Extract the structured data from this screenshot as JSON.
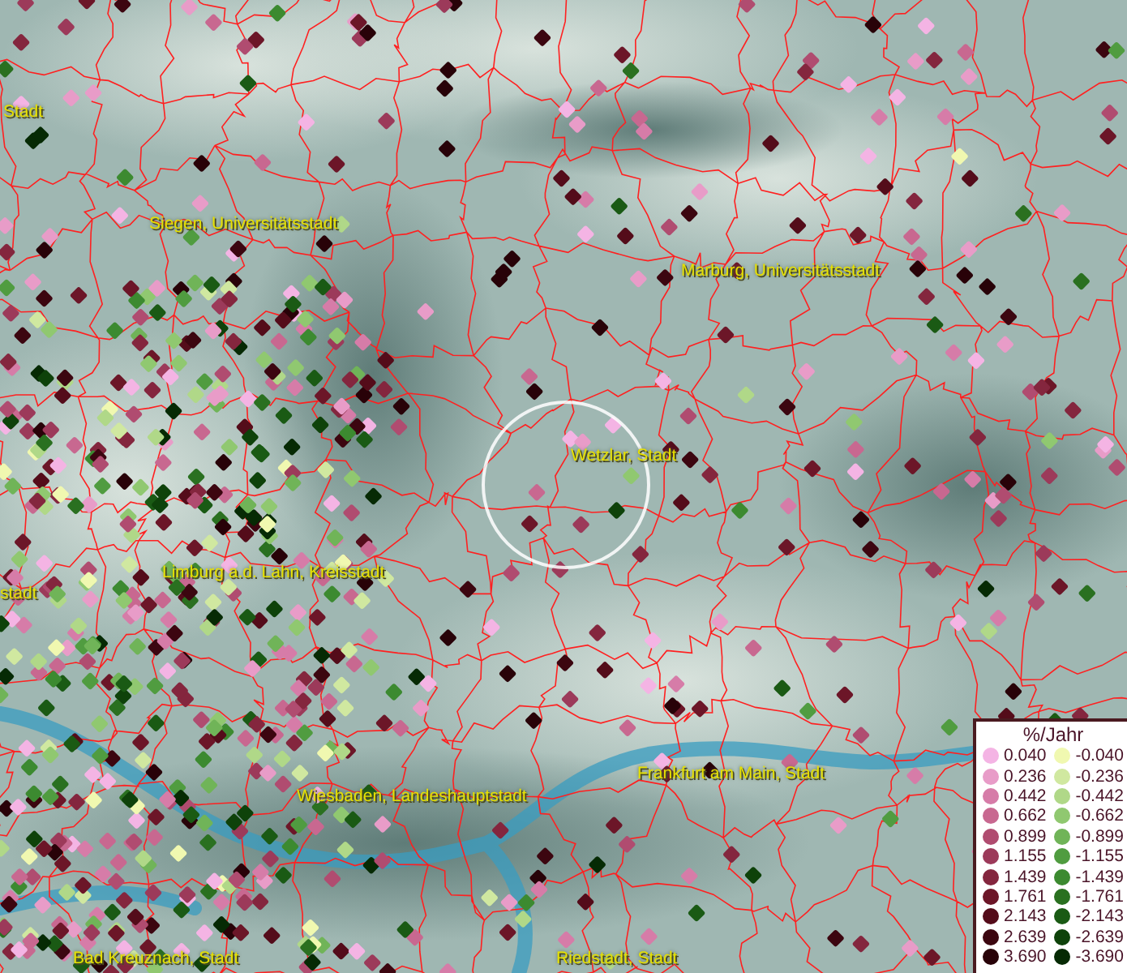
{
  "map": {
    "labels": [
      {
        "text": "Stadt"
      },
      {
        "text": "Siegen, Universitätsstadt"
      },
      {
        "text": "Marburg, Universitätsstadt"
      },
      {
        "text": "Wetzlar, Stadt"
      },
      {
        "text": "Limburg a.d. Lahn, Kreisstadt"
      },
      {
        "text": "stadt"
      },
      {
        "text": "Wiesbaden, Landeshauptstadt"
      },
      {
        "text": "Frankfurt am Main, Stadt"
      },
      {
        "text": "Bad Kreuznach, Stadt"
      },
      {
        "text": "Riedstadt, Stadt"
      }
    ]
  },
  "legend": {
    "title": "%/Jahr",
    "columns": [
      [
        {
          "label": "0.040",
          "color": "#f4b4e4"
        },
        {
          "label": "0.236",
          "color": "#e89cc8"
        },
        {
          "label": "0.442",
          "color": "#d67ca8"
        },
        {
          "label": "0.662",
          "color": "#c86890"
        },
        {
          "label": "0.899",
          "color": "#b04c70"
        },
        {
          "label": "1.155",
          "color": "#9c3a5a"
        },
        {
          "label": "1.439",
          "color": "#84263e"
        },
        {
          "label": "1.761",
          "color": "#6c1628"
        },
        {
          "label": "2.143",
          "color": "#540c1a"
        },
        {
          "label": "2.639",
          "color": "#3c0610"
        },
        {
          "label": "3.690",
          "color": "#280208"
        }
      ],
      [
        {
          "label": "-0.040",
          "color": "#f0f8b0"
        },
        {
          "label": "-0.236",
          "color": "#d0e8a0"
        },
        {
          "label": "-0.442",
          "color": "#b0d888"
        },
        {
          "label": "-0.662",
          "color": "#90c870"
        },
        {
          "label": "-0.899",
          "color": "#70b458"
        },
        {
          "label": "-1.155",
          "color": "#509c40"
        },
        {
          "label": "-1.439",
          "color": "#3c8a30"
        },
        {
          "label": "-1.761",
          "color": "#2a7020"
        },
        {
          "label": "-2.143",
          "color": "#1a5a14"
        },
        {
          "label": "-2.639",
          "color": "#0e420a"
        },
        {
          "label": "-3.690",
          "color": "#062a04"
        }
      ]
    ]
  }
}
